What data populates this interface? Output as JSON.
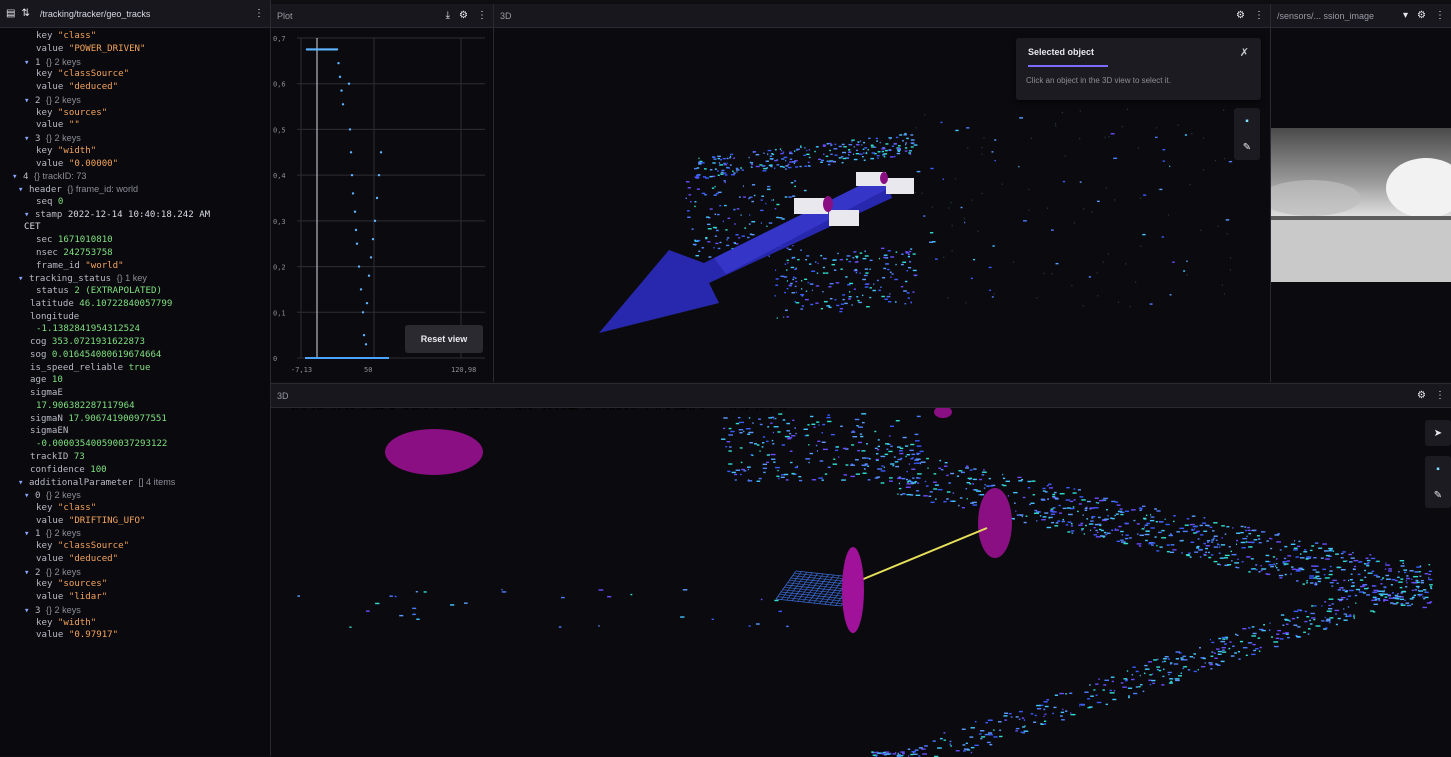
{
  "raw": {
    "topic": "/tracking/tracker/geo_tracks",
    "rows": [
      {
        "indent": 6,
        "key": "key",
        "str": "\"class\""
      },
      {
        "indent": 6,
        "key": "value",
        "str": "\"POWER_DRIVEN\""
      },
      {
        "indent": 4,
        "tri": "▾",
        "key": "1",
        "count": "{} 2 keys"
      },
      {
        "indent": 6,
        "key": "key",
        "str": "\"classSource\""
      },
      {
        "indent": 6,
        "key": "value",
        "str": "\"deduced\""
      },
      {
        "indent": 4,
        "tri": "▾",
        "key": "2",
        "count": "{} 2 keys"
      },
      {
        "indent": 6,
        "key": "key",
        "str": "\"sources\""
      },
      {
        "indent": 6,
        "key": "value",
        "str": "\"\""
      },
      {
        "indent": 4,
        "tri": "▾",
        "key": "3",
        "count": "{} 2 keys"
      },
      {
        "indent": 6,
        "key": "key",
        "str": "\"width\""
      },
      {
        "indent": 6,
        "key": "value",
        "str": "\"0.00000\""
      },
      {
        "indent": 2,
        "tri": "▾",
        "key": "4",
        "count": "{} trackID: 73"
      },
      {
        "indent": 3,
        "tri": "▾",
        "key": "header",
        "count": "{} frame_id: world"
      },
      {
        "indent": 6,
        "key": "seq",
        "num": "0"
      },
      {
        "indent": 4,
        "tri": "▾",
        "key": "stamp",
        "text": "2022-12-14 10:40:18.242 AM"
      },
      {
        "indent": 4,
        "key": "",
        "text": "CET"
      },
      {
        "indent": 6,
        "key": "sec",
        "num": "1671010810"
      },
      {
        "indent": 6,
        "key": "nsec",
        "num": "242753758"
      },
      {
        "indent": 6,
        "key": "frame_id",
        "str": "\"world\""
      },
      {
        "indent": 3,
        "tri": "▾",
        "key": "tracking_status",
        "count": "{} 1 key"
      },
      {
        "indent": 6,
        "key": "status",
        "num": "2 (EXTRAPOLATED)"
      },
      {
        "indent": 5,
        "key": "latitude",
        "num": "46.10722840057799"
      },
      {
        "indent": 5,
        "key": "longitude",
        "text": ""
      },
      {
        "indent": 6,
        "key": "",
        "num": "-1.1382841954312524"
      },
      {
        "indent": 5,
        "key": "cog",
        "num": "353.0721931622873"
      },
      {
        "indent": 5,
        "key": "sog",
        "num": "0.016454080619674664"
      },
      {
        "indent": 5,
        "key": "is_speed_reliable",
        "num": "true"
      },
      {
        "indent": 5,
        "key": "age",
        "num": "10"
      },
      {
        "indent": 5,
        "key": "sigmaE",
        "text": ""
      },
      {
        "indent": 6,
        "key": "",
        "num": "17.906382287117964"
      },
      {
        "indent": 5,
        "key": "sigmaN",
        "num": "17.906741900977551"
      },
      {
        "indent": 5,
        "key": "sigmaEN",
        "text": ""
      },
      {
        "indent": 6,
        "key": "",
        "num": "-0.000035400590037293122"
      },
      {
        "indent": 5,
        "key": "trackID",
        "num": "73"
      },
      {
        "indent": 5,
        "key": "confidence",
        "num": "100"
      },
      {
        "indent": 3,
        "tri": "▾",
        "key": "additionalParameter",
        "count": "[] 4 items"
      },
      {
        "indent": 4,
        "tri": "▾",
        "key": "0",
        "count": "{} 2 keys"
      },
      {
        "indent": 6,
        "key": "key",
        "str": "\"class\""
      },
      {
        "indent": 6,
        "key": "value",
        "str": "\"DRIFTING_UFO\""
      },
      {
        "indent": 4,
        "tri": "▾",
        "key": "1",
        "count": "{} 2 keys"
      },
      {
        "indent": 6,
        "key": "key",
        "str": "\"classSource\""
      },
      {
        "indent": 6,
        "key": "value",
        "str": "\"deduced\""
      },
      {
        "indent": 4,
        "tri": "▾",
        "key": "2",
        "count": "{} 2 keys"
      },
      {
        "indent": 6,
        "key": "key",
        "str": "\"sources\""
      },
      {
        "indent": 6,
        "key": "value",
        "str": "\"lidar\""
      },
      {
        "indent": 4,
        "tri": "▾",
        "key": "3",
        "count": "{} 2 keys"
      },
      {
        "indent": 6,
        "key": "key",
        "str": "\"width\""
      },
      {
        "indent": 6,
        "key": "value",
        "str": "\"0.97917\""
      }
    ]
  },
  "plot": {
    "title": "Plot",
    "reset_label": "Reset view",
    "chart_data": {
      "type": "scatter",
      "yticks": [
        "0,7",
        "0,6",
        "0,5",
        "0,4",
        "0,3",
        "0,2",
        "0,1",
        "0"
      ],
      "xticks": [
        "-7,13",
        "50",
        "120,98"
      ],
      "ylim": [
        0,
        0.7
      ],
      "xlim": [
        -7.13,
        120.98
      ],
      "grid": true
    }
  },
  "view3d_top": {
    "title": "3D",
    "selected_title": "Selected object",
    "selected_desc": "Click an object in the 3D view to select it."
  },
  "image_panel": {
    "title": "/sensors/... ssion_image"
  },
  "view3d_bottom": {
    "title": "3D"
  },
  "colors": {
    "accent": "#7b6cff",
    "string": "#f3a35c",
    "number": "#7fe07f",
    "arrow": "#2a2ab8",
    "ellipse": "#8a0f82"
  }
}
